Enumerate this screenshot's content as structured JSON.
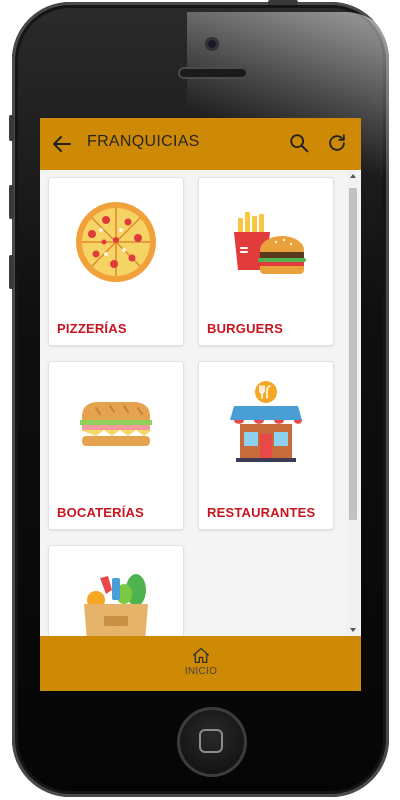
{
  "appbar": {
    "title": "FRANQUICIAS",
    "back_icon": "arrow-left-icon",
    "search_icon": "search-icon",
    "refresh_icon": "refresh-icon"
  },
  "categories": [
    {
      "label": "PIZZERÍAS",
      "icon": "pizza-icon"
    },
    {
      "label": "BURGUERS",
      "icon": "burger-fries-icon"
    },
    {
      "label": "BOCATERÍAS",
      "icon": "sandwich-icon"
    },
    {
      "label": "RESTAURANTES",
      "icon": "restaurant-storefront-icon"
    },
    {
      "label": "",
      "icon": "grocery-bag-icon"
    }
  ],
  "bottom_nav": {
    "home_label": "INICIO",
    "home_icon": "home-icon"
  },
  "colors": {
    "appbar": "#cf8a05",
    "label": "#c8151f",
    "background": "#f4f4f4"
  }
}
